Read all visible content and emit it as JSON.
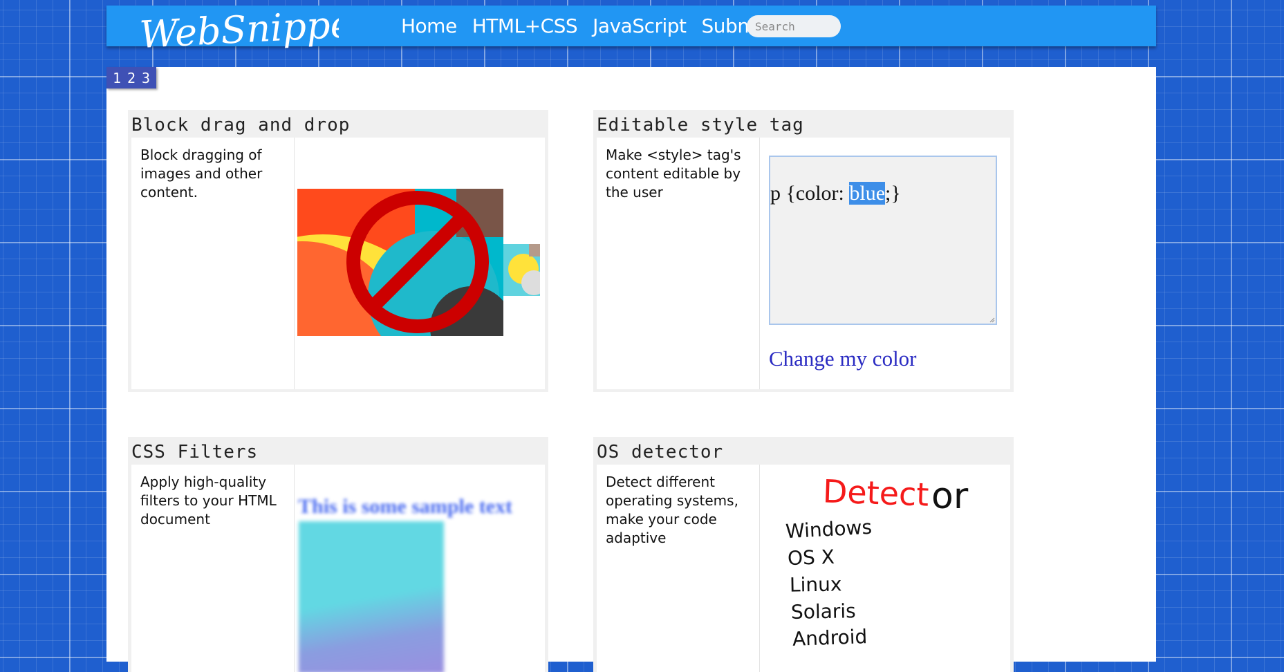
{
  "header": {
    "logo_text": "WebSnippets",
    "nav": [
      "Home",
      "HTML+CSS",
      "JavaScript",
      "Submit"
    ],
    "search_placeholder": "Search",
    "bg_color": "#2196f3"
  },
  "pager": [
    "1",
    "2",
    "3"
  ],
  "cards": [
    {
      "title": "Block drag and drop",
      "description": "Block dragging of images and other content."
    },
    {
      "title": "Editable style tag",
      "description": "Make <style> tag's content editable by the user",
      "code_before": "p {color: ",
      "code_selected": "blue",
      "code_after": ";}",
      "demo_text": "Change my color"
    },
    {
      "title": "CSS Filters",
      "description": "Apply high-quality filters to your HTML document",
      "demo_text": "This is some sample text"
    },
    {
      "title": "OS detector",
      "description": "Detect different operating systems, make your code adaptive",
      "demo_word_red": "Detect",
      "demo_word_black": "or",
      "os_list": [
        "Windows",
        "OS X",
        "Linux",
        "Solaris",
        "Android"
      ]
    }
  ]
}
